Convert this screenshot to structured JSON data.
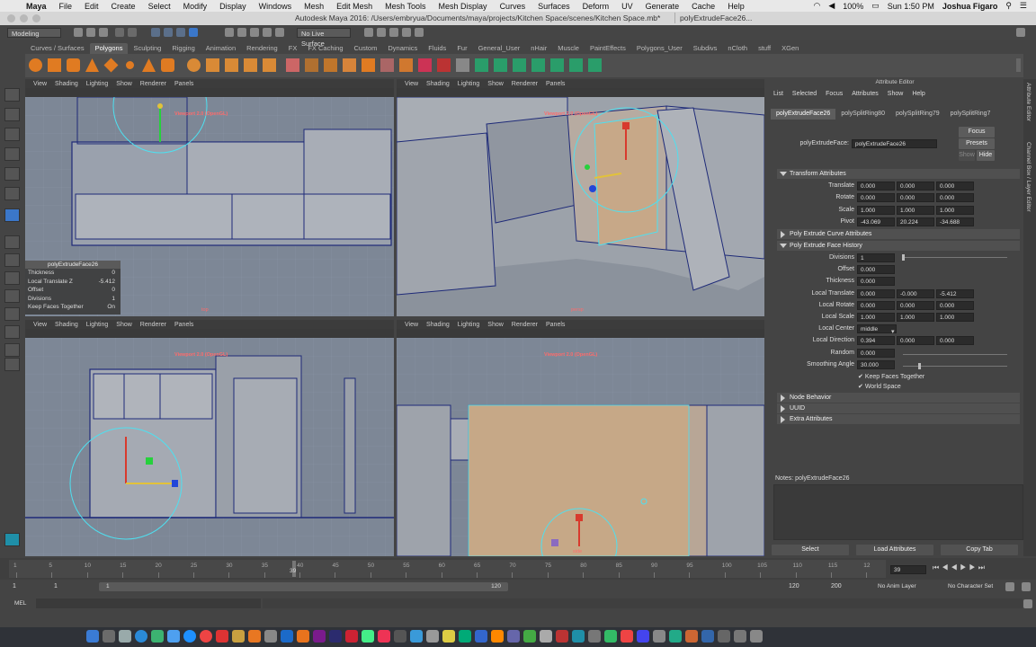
{
  "menubar": {
    "app": "Maya",
    "items": [
      "File",
      "Edit",
      "Create",
      "Select",
      "Modify",
      "Display",
      "Windows",
      "Mesh",
      "Edit Mesh",
      "Mesh Tools",
      "Mesh Display",
      "Curves",
      "Surfaces",
      "Deform",
      "UV",
      "Generate",
      "Cache",
      "Help"
    ],
    "battery": "100%",
    "clock": "Sun 1:50 PM",
    "user": "Joshua Figaro"
  },
  "titlebar": {
    "title": "Autodesk Maya 2016: /Users/embryua/Documents/maya/projects/Kitchen Space/scenes/Kitchen Space.mb*",
    "tab": "polyExtrudeFace26..."
  },
  "status": {
    "mode": "Modeling",
    "live_surface": "No Live Surface"
  },
  "shelf_tabs": [
    "Curves / Surfaces",
    "Polygons",
    "Sculpting",
    "Rigging",
    "Animation",
    "Rendering",
    "FX",
    "FX Caching",
    "Custom",
    "Dynamics",
    "Fluids",
    "Fur",
    "General_User",
    "nHair",
    "Muscle",
    "PaintEffects",
    "Polygons_User",
    "Subdivs",
    "nCloth",
    "stuff",
    "XGen"
  ],
  "shelf_active": "Polygons",
  "viewport_menus": [
    "View",
    "Shading",
    "Lighting",
    "Show",
    "Renderer",
    "Panels"
  ],
  "viewports": {
    "renderer_label": "Viewport 2.0 (OpenGL)",
    "top_label": "top",
    "persp_label": "persp",
    "side_label": "side"
  },
  "channel_box": {
    "header": "polyExtrudeFace26",
    "rows": [
      {
        "label": "Thickness",
        "value": "0"
      },
      {
        "label": "Local Translate Z",
        "value": "-5.412"
      },
      {
        "label": "Offset",
        "value": "0"
      },
      {
        "label": "Divisions",
        "value": "1"
      },
      {
        "label": "Keep Faces Together",
        "value": "On"
      }
    ]
  },
  "attribute_editor": {
    "title": "Attribute Editor",
    "menus": [
      "List",
      "Selected",
      "Focus",
      "Attributes",
      "Show",
      "Help"
    ],
    "tabs": [
      "polyExtrudeFace26",
      "polySplitRing80",
      "polySplitRing79",
      "polySplitRing7"
    ],
    "node_label": "polyExtrudeFace:",
    "node_value": "polyExtrudeFace26",
    "buttons": {
      "focus": "Focus",
      "presets": "Presets",
      "show": "Show",
      "hide": "Hide"
    },
    "sections": {
      "transform": "Transform Attributes",
      "curve": "Poly Extrude Curve Attributes",
      "history": "Poly Extrude Face History",
      "node_behavior": "Node Behavior",
      "uuid": "UUID",
      "extra": "Extra Attributes"
    },
    "transform_rows": [
      {
        "label": "Translate",
        "v": [
          "0.000",
          "0.000",
          "0.000"
        ]
      },
      {
        "label": "Rotate",
        "v": [
          "0.000",
          "0.000",
          "0.000"
        ]
      },
      {
        "label": "Scale",
        "v": [
          "1.000",
          "1.000",
          "1.000"
        ]
      },
      {
        "label": "Pivot",
        "v": [
          "-43.069",
          "20.224",
          "-34.688"
        ]
      }
    ],
    "history_rows": [
      {
        "label": "Divisions",
        "v": [
          "1"
        ]
      },
      {
        "label": "Offset",
        "v": [
          "0.000"
        ]
      },
      {
        "label": "Thickness",
        "v": [
          "0.000"
        ]
      },
      {
        "label": "Local Translate",
        "v": [
          "0.000",
          "-0.000",
          "-5.412"
        ]
      },
      {
        "label": "Local Rotate",
        "v": [
          "0.000",
          "0.000",
          "0.000"
        ]
      },
      {
        "label": "Local Scale",
        "v": [
          "1.000",
          "1.000",
          "1.000"
        ]
      },
      {
        "label": "Local Center",
        "v": [
          "middle"
        ]
      },
      {
        "label": "Local Direction",
        "v": [
          "0.394",
          "0.000",
          "0.000"
        ]
      },
      {
        "label": "Random",
        "v": [
          "0.000"
        ]
      },
      {
        "label": "Smoothing Angle",
        "v": [
          "30.000"
        ]
      }
    ],
    "checkboxes": [
      "Keep Faces Together",
      "World Space"
    ],
    "notes": "Notes:  polyExtrudeFace26",
    "bottom_buttons": [
      "Select",
      "Load Attributes",
      "Copy Tab"
    ]
  },
  "vertical_tabs": [
    "Attribute Editor",
    "Channel Box / Layer Editor"
  ],
  "timeline": {
    "ticks": [
      "1",
      "5",
      "10",
      "15",
      "20",
      "25",
      "30",
      "35",
      "40",
      "45",
      "50",
      "55",
      "60",
      "65",
      "70",
      "75",
      "80",
      "85",
      "90",
      "95",
      "100",
      "105",
      "110",
      "115",
      "12"
    ],
    "current_frame": "39",
    "frame_field": "39"
  },
  "range": {
    "start": "1",
    "start_inner": "1",
    "slider_start": "1",
    "slider_end": "120",
    "end_inner": "120",
    "end": "200",
    "anim_layer": "No Anim Layer",
    "character_set": "No Character Set"
  },
  "mel": {
    "label": "MEL"
  }
}
